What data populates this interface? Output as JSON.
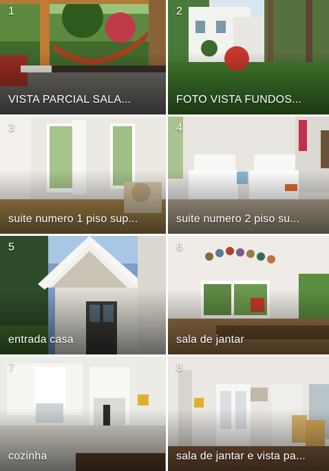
{
  "gallery": {
    "tiles": [
      {
        "number": "1",
        "caption": "VISTA PARCIAL  SALA..."
      },
      {
        "number": "2",
        "caption": "FOTO VISTA FUNDOS..."
      },
      {
        "number": "3",
        "caption": "suite numero 1 piso sup..."
      },
      {
        "number": "4",
        "caption": "suite numero 2  piso su..."
      },
      {
        "number": "5",
        "caption": "entrada casa"
      },
      {
        "number": "6",
        "caption": "sala de jantar"
      },
      {
        "number": "7",
        "caption": "cozinha"
      },
      {
        "number": "8",
        "caption": "sala de jantar e vista pa..."
      }
    ]
  }
}
